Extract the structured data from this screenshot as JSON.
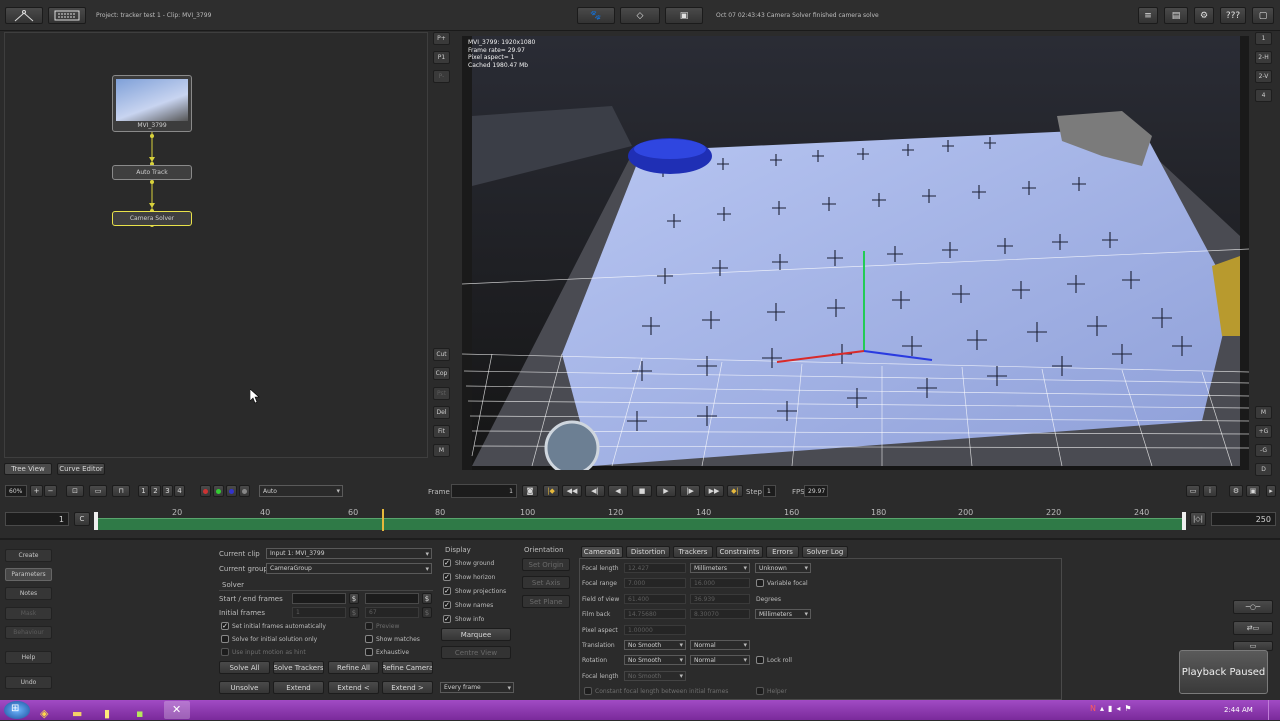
{
  "title_bar": {
    "project_label": "Project: tracker test 1 - Clip: MVI_3799",
    "status_message": "Oct 07 02:43:43 Camera Solver finished camera solve",
    "help_label": "???"
  },
  "node_graph": {
    "nodes": [
      "MVI_3799",
      "Auto Track",
      "Camera Solver"
    ],
    "side_buttons": [
      "P+",
      "P1",
      "P-",
      "Cut",
      "Cop",
      "Pst",
      "Del",
      "Fit",
      "M"
    ],
    "tabs": [
      "Tree View",
      "Curve Editor"
    ]
  },
  "viewer": {
    "info_lines": [
      "MVI_3799: 1920x1080",
      "Frame rate= 29.97",
      "Pixel aspect= 1",
      "Cached 1980.47 Mb"
    ],
    "right_buttons": [
      "1",
      "2-H",
      "2-V",
      "4"
    ],
    "right_buttons_lower": [
      "M",
      "+G",
      "-G",
      "D"
    ]
  },
  "playbar": {
    "zoom": "60%",
    "view_buttons": [
      "1",
      "2",
      "3",
      "4"
    ],
    "mode_select": "Auto",
    "frame_label": "Frame",
    "frame_value": "1",
    "step_label": "Step",
    "step_value": "1",
    "fps_label": "FPS",
    "fps_value": "29.97"
  },
  "timeline": {
    "start": "1",
    "c_label": "C",
    "end": "250",
    "ticks": [
      "20",
      "40",
      "60",
      "80",
      "100",
      "120",
      "140",
      "160",
      "180",
      "200",
      "220",
      "240"
    ]
  },
  "left_nav": [
    "Create",
    "Parameters",
    "Notes",
    "Mask",
    "Behaviour",
    "Help",
    "Undo"
  ],
  "solver_panel": {
    "current_clip_label": "Current clip",
    "current_clip_value": "Input 1: MVI_3799",
    "current_group_label": "Current group",
    "current_group_value": "CameraGroup",
    "solver_heading": "Solver",
    "start_end_label": "Start / end frames",
    "initial_frames_label": "Initial frames",
    "initial_frame_a": "1",
    "initial_frame_b": "67",
    "set_initial_auto": "Set initial frames automatically",
    "solve_initial_only": "Solve for initial solution only",
    "use_input_motion": "Use input motion as hint",
    "preview": "Preview",
    "show_matches": "Show matches",
    "exhaustive": "Exhaustive",
    "buttons_row1": [
      "Solve All",
      "Solve Trackers",
      "Refine All",
      "Refine Camera"
    ],
    "buttons_row2": [
      "Unsolve",
      "Extend",
      "Extend <",
      "Extend >"
    ]
  },
  "display_panel": {
    "heading": "Display",
    "options": [
      "Show ground",
      "Show horizon",
      "Show projections",
      "Show names",
      "Show info"
    ],
    "marquee": "Marquee",
    "centre_view": "Centre View",
    "every_frame": "Every frame"
  },
  "orientation_panel": {
    "heading": "Orientation",
    "buttons": [
      "Set Origin",
      "Set Axis",
      "Set Plane"
    ]
  },
  "camera_panel": {
    "tabs": [
      "Camera01",
      "Distortion",
      "Trackers",
      "Constraints",
      "Errors",
      "Solver Log"
    ],
    "focal_length_label": "Focal length",
    "focal_length_value": "12.427",
    "focal_units": "Millimeters",
    "focal_known": "Unknown",
    "focal_range_label": "Focal range",
    "focal_range_min": "7.000",
    "focal_range_max": "16.000",
    "variable_focal": "Variable focal",
    "fov_label": "Field of view",
    "fov_a": "61.400",
    "fov_b": "36.939",
    "degrees": "Degrees",
    "film_back_label": "Film back",
    "film_back_a": "14.75680",
    "film_back_b": "8.30070",
    "film_units": "Millimeters",
    "pixel_aspect_label": "Pixel aspect",
    "pixel_aspect_value": "1.00000",
    "translation_label": "Translation",
    "translation_smooth": "No Smooth",
    "translation_mode": "Normal",
    "rotation_label": "Rotation",
    "rotation_smooth": "No Smooth",
    "rotation_mode": "Normal",
    "lock_roll": "Lock roll",
    "focal_length2_label": "Focal length",
    "focal_length2_smooth": "No Smooth",
    "constant_focal": "Constant focal length between initial frames",
    "helper": "Helper"
  },
  "notification": "Playback Paused",
  "taskbar": {
    "clock": "2:44 AM"
  },
  "colors": {
    "background": "#2b2b2b",
    "taskbar": "#8e37b0",
    "timeline_green": "#2f7a47",
    "node_selected": "#e9e24a"
  }
}
